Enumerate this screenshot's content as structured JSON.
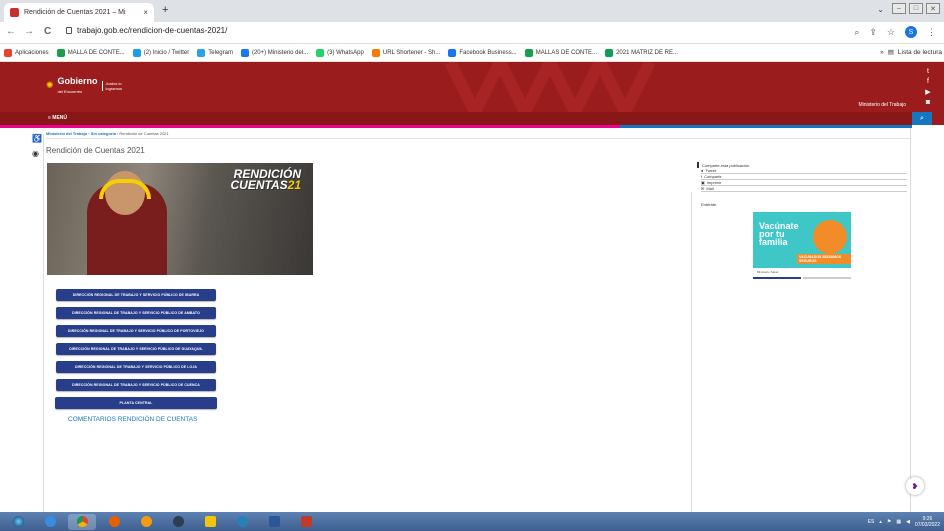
{
  "browser": {
    "tab_title": "Rendición de Cuentas 2021 – Mi",
    "tab_close": "×",
    "new_tab": "+",
    "url": "trabajo.gob.ec/rendicion-de-cuentas-2021/",
    "profile_initial": "S",
    "back": "←",
    "forward": "→",
    "reload": "C",
    "bookmarks": [
      {
        "label": "Aplicaciones",
        "color": "#e94235"
      },
      {
        "label": "MALLA DE CONTE...",
        "color": "#1a9e4b"
      },
      {
        "label": "(2) Inicio / Twitter",
        "color": "#1d9bf0"
      },
      {
        "label": "Telegram",
        "color": "#2aa3df"
      },
      {
        "label": "(20+) Ministerio del...",
        "color": "#1877f2"
      },
      {
        "label": "(3) WhatsApp",
        "color": "#25d366"
      },
      {
        "label": "URL Shortener - Sh...",
        "color": "#f57c00"
      },
      {
        "label": "Facebook Business...",
        "color": "#1877f2"
      },
      {
        "label": "MALLAS DE CONTE...",
        "color": "#1a9e4b"
      },
      {
        "label": "2021 MATRIZ DE RE...",
        "color": "#0f9d58"
      }
    ],
    "more_bookmarks": "»",
    "reading_list": "Lista de lectura"
  },
  "site": {
    "logo_main": "Gobierno",
    "logo_sub": "del Encuentro",
    "logo_tag": "Juntos lo logramos",
    "ministry": "Ministerio del Trabajo",
    "menu": "≡ MENÚ",
    "social": [
      "t",
      "f",
      "▶",
      "◙"
    ],
    "search_icon": "🔍"
  },
  "breadcrumb": {
    "home": "Ministerio del Trabajo",
    "sep1": " › ",
    "cat": "Sin categoría",
    "sep2": " › ",
    "current": "Rendición de Cuentas 2021"
  },
  "page_title": "Rendición de Cuentas 2021",
  "banner_text": [
    "RENDICIÓN",
    "CUENTAS"
  ],
  "banner_year": "21",
  "buttons": [
    "DIRECCIÓN REGIONAL DE TRABAJO Y SERVICIO PÚBLICO DE IBARRA",
    "DIRECCIÓN REGIONAL DE TRABAJO Y SERVICIO PÚBLICO DE AMBATO",
    "DIRECCIÓN REGIONAL DE TRABAJO Y SERVICIO PÚBLICO DE PORTOVIEJO",
    "DIRECCIÓN REGIONAL DE TRABAJO Y SERVICIO PÚBLICO DE GUAYAQUIL",
    "DIRECCIÓN REGIONAL DE TRABAJO Y SERVICIO PÚBLICO DE LOJA",
    "DIRECCIÓN REGIONAL DE TRABAJO Y SERVICIO PÚBLICO DE CUENCA",
    "PLANTA CENTRAL"
  ],
  "comments_link": "COMENTARIOS RENDICIÓN DE CUENTAS",
  "share": {
    "heading": "Comparte esta publicación",
    "items": [
      "Tweet",
      "Compartir",
      "Imprimir",
      "Mail"
    ]
  },
  "enterate": "Entérate",
  "vacuna": {
    "line1": "Vacúnate",
    "line2": "por tu",
    "line3": "familia",
    "badge": "VACUNADOS SEGUIMOS SEGUROS",
    "footer": "Ministerio Salud"
  },
  "taskbar": {
    "lang": "ES",
    "time": "9:26",
    "date": "07/03/2022"
  }
}
